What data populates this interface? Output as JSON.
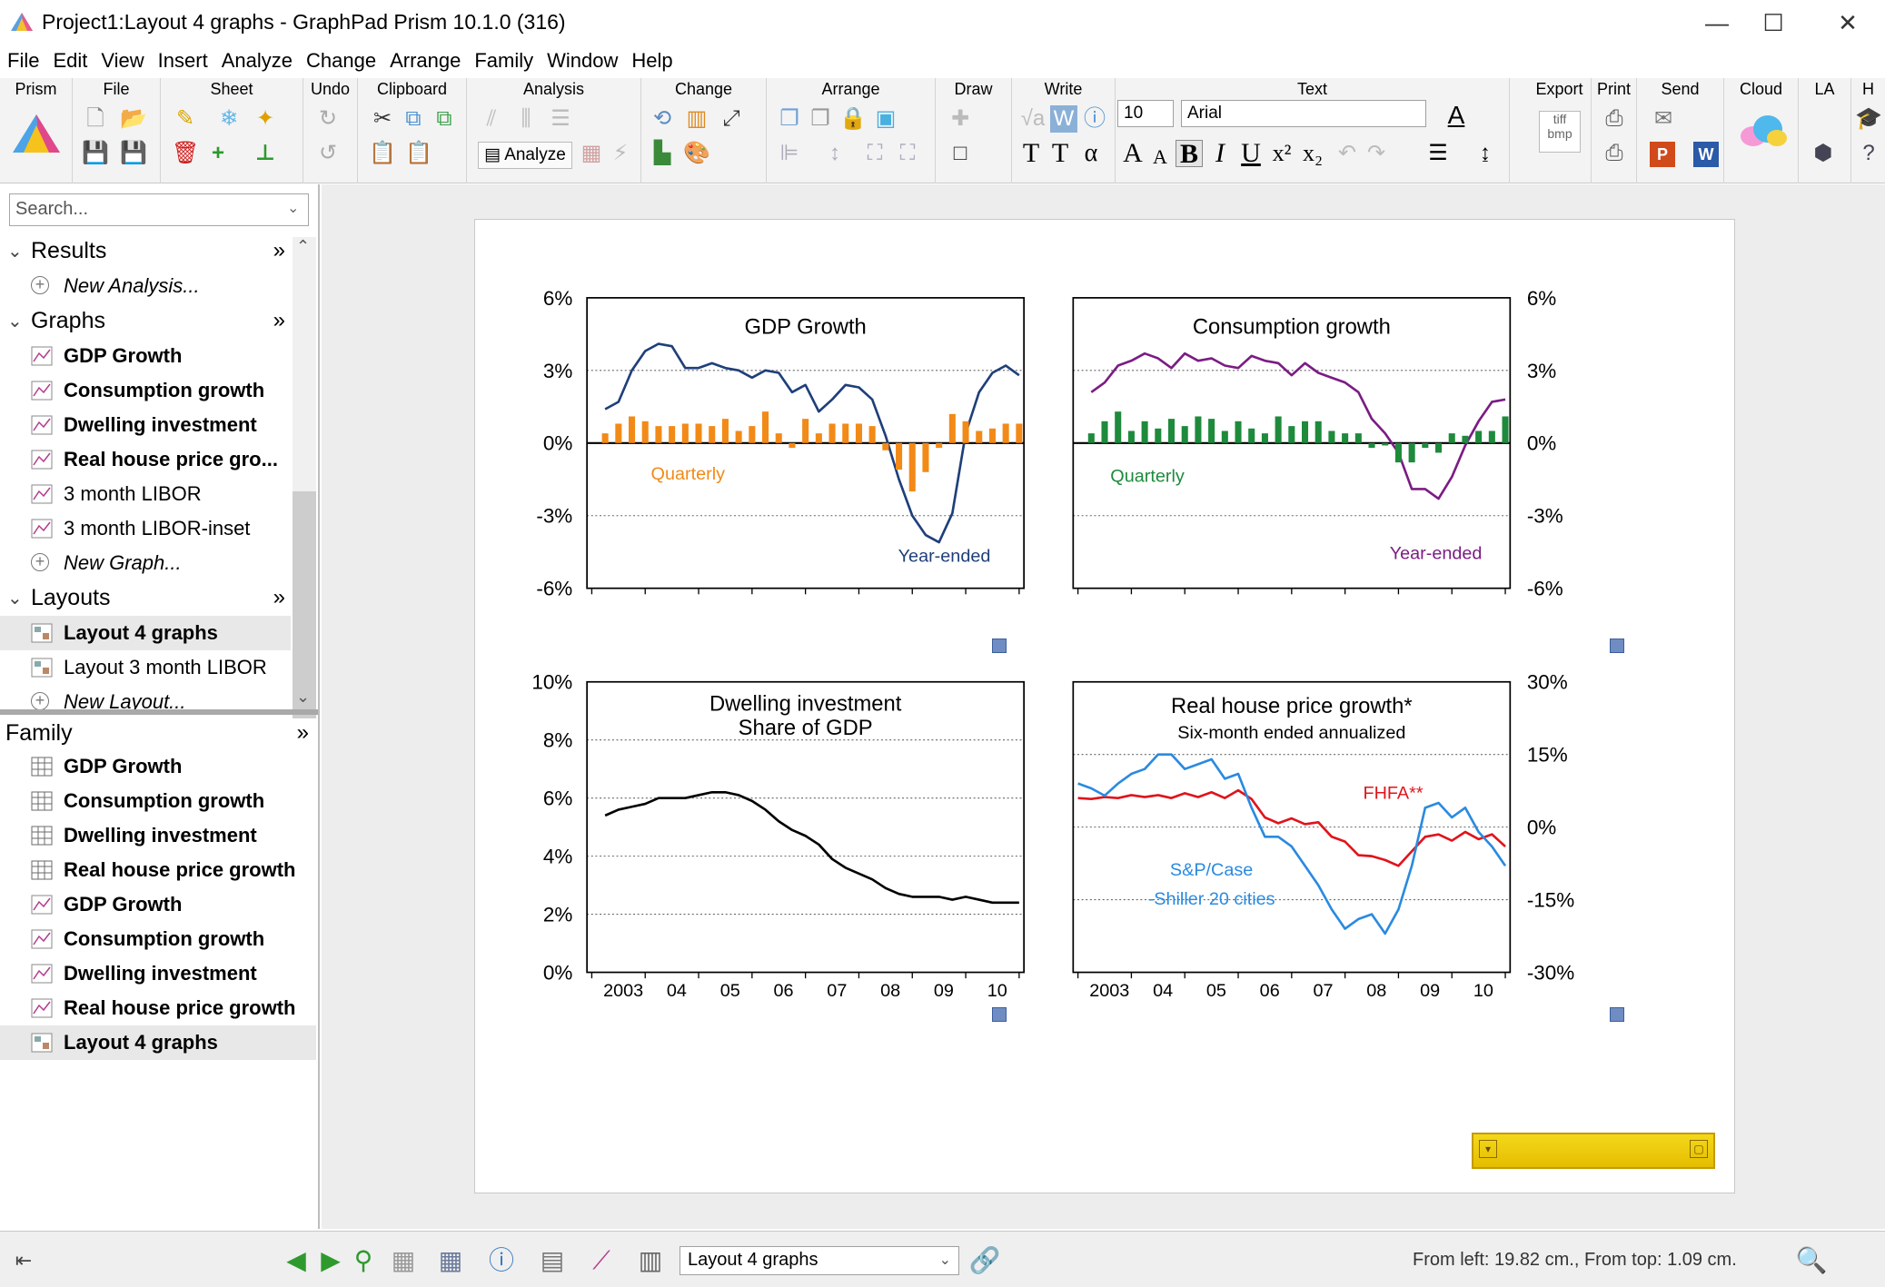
{
  "window": {
    "title": "Project1:Layout 4 graphs - GraphPad Prism 10.1.0 (316)",
    "controls": [
      "—",
      "☐",
      "✕"
    ]
  },
  "menubar": [
    "File",
    "Edit",
    "View",
    "Insert",
    "Analyze",
    "Change",
    "Arrange",
    "Family",
    "Window",
    "Help"
  ],
  "ribbon": {
    "groups": [
      "Prism",
      "File",
      "Sheet",
      "Undo",
      "Clipboard",
      "Analysis",
      "Change",
      "Arrange",
      "Draw",
      "Write",
      "Text",
      "Export",
      "Print",
      "Send",
      "Cloud",
      "LA",
      "H"
    ],
    "analyze_label": "Analyze",
    "font_size": "10",
    "font_name": "Arial"
  },
  "navigator": {
    "search_placeholder": "Search...",
    "results": {
      "title": "Results",
      "items": [
        {
          "label": "New Analysis...",
          "style": "italic"
        }
      ]
    },
    "graphs": {
      "title": "Graphs",
      "items": [
        {
          "label": "GDP Growth",
          "style": "bold"
        },
        {
          "label": "Consumption growth",
          "style": "bold"
        },
        {
          "label": "Dwelling investment",
          "style": "bold"
        },
        {
          "label": "Real house price gro...",
          "style": "bold"
        },
        {
          "label": "3 month LIBOR",
          "style": "normal"
        },
        {
          "label": "3 month LIBOR-inset",
          "style": "normal"
        },
        {
          "label": "New Graph...",
          "style": "italic"
        }
      ]
    },
    "layouts": {
      "title": "Layouts",
      "items": [
        {
          "label": "Layout 4 graphs",
          "style": "bold",
          "selected": true
        },
        {
          "label": "Layout 3 month LIBOR",
          "style": "normal"
        },
        {
          "label": "New Layout...",
          "style": "italic"
        }
      ]
    },
    "family": {
      "title": "Family",
      "items": [
        {
          "label": "GDP Growth",
          "icon": "table-icon"
        },
        {
          "label": "Consumption growth",
          "icon": "table-icon"
        },
        {
          "label": "Dwelling investment",
          "icon": "table-icon"
        },
        {
          "label": "Real house price growth",
          "icon": "table-icon"
        },
        {
          "label": "GDP Growth",
          "icon": "graph-icon"
        },
        {
          "label": "Consumption growth",
          "icon": "graph-icon"
        },
        {
          "label": "Dwelling investment",
          "icon": "graph-icon"
        },
        {
          "label": "Real house price growth",
          "icon": "graph-icon"
        },
        {
          "label": "Layout 4 graphs",
          "icon": "layout-icon",
          "selected": true
        }
      ]
    }
  },
  "statusbar": {
    "sheet": "Layout 4 graphs",
    "position": "From left: 19.82 cm., From top: 1.09 cm."
  },
  "colors": {
    "gdp_line": "#1f3f7a",
    "gdp_bars": "#f28a17",
    "cons_line": "#7b1c84",
    "cons_bars": "#1e8a3c",
    "fhfa": "#e0141b",
    "sp": "#2a8ae0"
  },
  "chart_data": [
    {
      "type": "line",
      "title": "GDP Growth",
      "ylim": [
        -6,
        6
      ],
      "yticks": [
        "6%",
        "3%",
        "0%",
        "-3%",
        "-6%"
      ],
      "xlim": [
        2002.0,
        2010.0
      ],
      "grid": true,
      "annotations": [
        {
          "text": "Quarterly",
          "x": 2003.8,
          "y": -1.5,
          "color": "#f28a17"
        },
        {
          "text": "Year-ended",
          "x": 2008.6,
          "y": -4.9,
          "color": "#1f3f7a"
        }
      ],
      "series": [
        {
          "name": "Year-ended",
          "kind": "line",
          "color": "#1f3f7a",
          "x": [
            2002.25,
            2002.5,
            2002.75,
            2003.0,
            2003.25,
            2003.5,
            2003.75,
            2004.0,
            2004.25,
            2004.5,
            2004.75,
            2005.0,
            2005.25,
            2005.5,
            2005.75,
            2006.0,
            2006.25,
            2006.5,
            2006.75,
            2007.0,
            2007.25,
            2007.5,
            2007.75,
            2008.0,
            2008.25,
            2008.5,
            2008.75,
            2009.0,
            2009.25,
            2009.5,
            2009.75,
            2010.0
          ],
          "y": [
            1.4,
            1.7,
            3.0,
            3.8,
            4.1,
            4.0,
            3.1,
            3.1,
            3.3,
            3.1,
            3.0,
            2.7,
            3.0,
            2.9,
            2.1,
            2.4,
            1.3,
            1.8,
            2.4,
            2.3,
            1.8,
            0.3,
            -1.5,
            -3.0,
            -3.8,
            -4.1,
            -2.9,
            0.4,
            2.1,
            2.9,
            3.2,
            2.8
          ]
        },
        {
          "name": "Quarterly",
          "kind": "bar",
          "color": "#f28a17",
          "x": [
            2002.25,
            2002.5,
            2002.75,
            2003.0,
            2003.25,
            2003.5,
            2003.75,
            2004.0,
            2004.25,
            2004.5,
            2004.75,
            2005.0,
            2005.25,
            2005.5,
            2005.75,
            2006.0,
            2006.25,
            2006.5,
            2006.75,
            2007.0,
            2007.25,
            2007.5,
            2007.75,
            2008.0,
            2008.25,
            2008.5,
            2008.75,
            2009.0,
            2009.25,
            2009.5,
            2009.75,
            2010.0
          ],
          "y": [
            0.4,
            0.8,
            1.1,
            0.9,
            0.7,
            0.7,
            0.8,
            0.8,
            0.7,
            1.0,
            0.5,
            0.7,
            1.3,
            0.4,
            -0.2,
            1.0,
            0.4,
            0.8,
            0.8,
            0.8,
            0.7,
            -0.3,
            -1.1,
            -2.0,
            -1.2,
            -0.2,
            1.2,
            0.9,
            0.5,
            0.6,
            0.8,
            0.8
          ]
        }
      ]
    },
    {
      "type": "line",
      "title": "Consumption growth",
      "ylim": [
        -6,
        6
      ],
      "yticks": [
        "6%",
        "3%",
        "0%",
        "-3%",
        "-6%"
      ],
      "xlim": [
        2002.0,
        2010.0
      ],
      "grid": true,
      "annotations": [
        {
          "text": "Quarterly",
          "x": 2003.3,
          "y": -1.6,
          "color": "#1e8a3c"
        },
        {
          "text": "Year-ended",
          "x": 2008.7,
          "y": -4.8,
          "color": "#7b1c84"
        }
      ],
      "series": [
        {
          "name": "Year-ended",
          "kind": "line",
          "color": "#7b1c84",
          "x": [
            2002.25,
            2002.5,
            2002.75,
            2003.0,
            2003.25,
            2003.5,
            2003.75,
            2004.0,
            2004.25,
            2004.5,
            2004.75,
            2005.0,
            2005.25,
            2005.5,
            2005.75,
            2006.0,
            2006.25,
            2006.5,
            2006.75,
            2007.0,
            2007.25,
            2007.5,
            2007.75,
            2008.0,
            2008.25,
            2008.5,
            2008.75,
            2009.0,
            2009.25,
            2009.5,
            2009.75,
            2010.0
          ],
          "y": [
            2.1,
            2.5,
            3.2,
            3.4,
            3.7,
            3.5,
            3.1,
            3.7,
            3.4,
            3.5,
            3.2,
            3.1,
            3.6,
            3.4,
            3.3,
            2.8,
            3.3,
            2.9,
            2.7,
            2.5,
            2.1,
            1.0,
            0.4,
            -0.4,
            -1.9,
            -1.9,
            -2.3,
            -1.4,
            -0.1,
            0.9,
            1.7,
            1.8
          ]
        },
        {
          "name": "Quarterly",
          "kind": "bar",
          "color": "#1e8a3c",
          "x": [
            2002.25,
            2002.5,
            2002.75,
            2003.0,
            2003.25,
            2003.5,
            2003.75,
            2004.0,
            2004.25,
            2004.5,
            2004.75,
            2005.0,
            2005.25,
            2005.5,
            2005.75,
            2006.0,
            2006.25,
            2006.5,
            2006.75,
            2007.0,
            2007.25,
            2007.5,
            2007.75,
            2008.0,
            2008.25,
            2008.5,
            2008.75,
            2009.0,
            2009.25,
            2009.5,
            2009.75,
            2010.0
          ],
          "y": [
            0.4,
            0.9,
            1.3,
            0.5,
            0.9,
            0.6,
            1.0,
            0.7,
            1.1,
            1.0,
            0.5,
            0.9,
            0.6,
            0.4,
            1.1,
            0.7,
            0.9,
            0.9,
            0.5,
            0.4,
            0.4,
            -0.2,
            -0.1,
            -0.8,
            -0.8,
            -0.2,
            -0.4,
            0.4,
            0.3,
            0.5,
            0.5,
            1.1
          ]
        }
      ]
    },
    {
      "type": "line",
      "title": "Dwelling investment",
      "subtitle": "Share of GDP",
      "ylim": [
        0,
        10
      ],
      "yticks": [
        "10%",
        "8%",
        "6%",
        "4%",
        "2%",
        "0%"
      ],
      "xlim": [
        2002.0,
        2010.0
      ],
      "xticks": [
        "2003",
        "04",
        "05",
        "06",
        "07",
        "08",
        "09",
        "10"
      ],
      "grid": true,
      "series": [
        {
          "name": "Dwelling investment",
          "kind": "line",
          "color": "#000000",
          "x": [
            2002.25,
            2002.5,
            2002.75,
            2003.0,
            2003.25,
            2003.5,
            2003.75,
            2004.0,
            2004.25,
            2004.5,
            2004.75,
            2005.0,
            2005.25,
            2005.5,
            2005.75,
            2006.0,
            2006.25,
            2006.5,
            2006.75,
            2007.0,
            2007.25,
            2007.5,
            2007.75,
            2008.0,
            2008.25,
            2008.5,
            2008.75,
            2009.0,
            2009.25,
            2009.5,
            2009.75,
            2010.0
          ],
          "y": [
            5.4,
            5.6,
            5.7,
            5.8,
            6.0,
            6.0,
            6.0,
            6.1,
            6.2,
            6.2,
            6.1,
            5.9,
            5.6,
            5.2,
            4.9,
            4.7,
            4.4,
            3.9,
            3.6,
            3.4,
            3.2,
            2.9,
            2.7,
            2.6,
            2.6,
            2.6,
            2.5,
            2.6,
            2.5,
            2.4,
            2.4,
            2.4
          ]
        }
      ]
    },
    {
      "type": "line",
      "title": "Real house price growth*",
      "subtitle": "Six-month ended annualized",
      "ylim": [
        -30,
        30
      ],
      "yticks": [
        "30%",
        "15%",
        "0%",
        "-15%",
        "-30%"
      ],
      "xlim": [
        2002.0,
        2010.0
      ],
      "xticks": [
        "2003",
        "04",
        "05",
        "06",
        "07",
        "08",
        "09",
        "10"
      ],
      "grid": true,
      "annotations": [
        {
          "text": "FHFA**",
          "x": 2007.9,
          "y": 5.8,
          "color": "#e0141b"
        },
        {
          "text": "S&P/Case",
          "x": 2004.5,
          "y": -10.0,
          "color": "#2a8ae0"
        },
        {
          "text": "-Shiller 20 cities",
          "x": 2004.5,
          "y": -16.0,
          "color": "#2a8ae0"
        }
      ],
      "series": [
        {
          "name": "FHFA**",
          "kind": "line",
          "color": "#e0141b",
          "x": [
            2002.0,
            2002.25,
            2002.5,
            2002.75,
            2003.0,
            2003.25,
            2003.5,
            2003.75,
            2004.0,
            2004.25,
            2004.5,
            2004.75,
            2005.0,
            2005.25,
            2005.5,
            2005.75,
            2006.0,
            2006.25,
            2006.5,
            2006.75,
            2007.0,
            2007.25,
            2007.5,
            2007.75,
            2008.0,
            2008.25,
            2008.5,
            2008.75,
            2009.0,
            2009.25,
            2009.5,
            2009.75,
            2010.0
          ],
          "y": [
            6.0,
            5.8,
            6.2,
            6.0,
            6.6,
            6.2,
            6.6,
            6.0,
            7.0,
            6.2,
            7.2,
            6.0,
            7.6,
            5.8,
            2.0,
            0.8,
            1.8,
            0.6,
            1.0,
            -2.0,
            -3.0,
            -5.8,
            -6.0,
            -6.8,
            -8.0,
            -5.0,
            -2.0,
            -1.5,
            -2.8,
            -1.0,
            -2.5,
            -1.5,
            -4.0
          ]
        },
        {
          "name": "S&P/Case-Shiller 20 cities",
          "kind": "line",
          "color": "#2a8ae0",
          "x": [
            2002.0,
            2002.25,
            2002.5,
            2002.75,
            2003.0,
            2003.25,
            2003.5,
            2003.75,
            2004.0,
            2004.25,
            2004.5,
            2004.75,
            2005.0,
            2005.25,
            2005.5,
            2005.75,
            2006.0,
            2006.25,
            2006.5,
            2006.75,
            2007.0,
            2007.25,
            2007.5,
            2007.75,
            2008.0,
            2008.25,
            2008.5,
            2008.75,
            2009.0,
            2009.25,
            2009.5,
            2009.75,
            2010.0
          ],
          "y": [
            9.0,
            8.0,
            6.5,
            9.0,
            11.0,
            12.0,
            15.0,
            15.0,
            12.0,
            13.0,
            14.0,
            10.0,
            11.0,
            4.0,
            -2.0,
            -2.0,
            -4.0,
            -8.0,
            -12.0,
            -17.0,
            -21.0,
            -19.0,
            -18.0,
            -22.0,
            -17.0,
            -8.0,
            4.0,
            5.0,
            2.0,
            4.0,
            -1.0,
            -4.0,
            -8.0
          ]
        }
      ]
    }
  ]
}
